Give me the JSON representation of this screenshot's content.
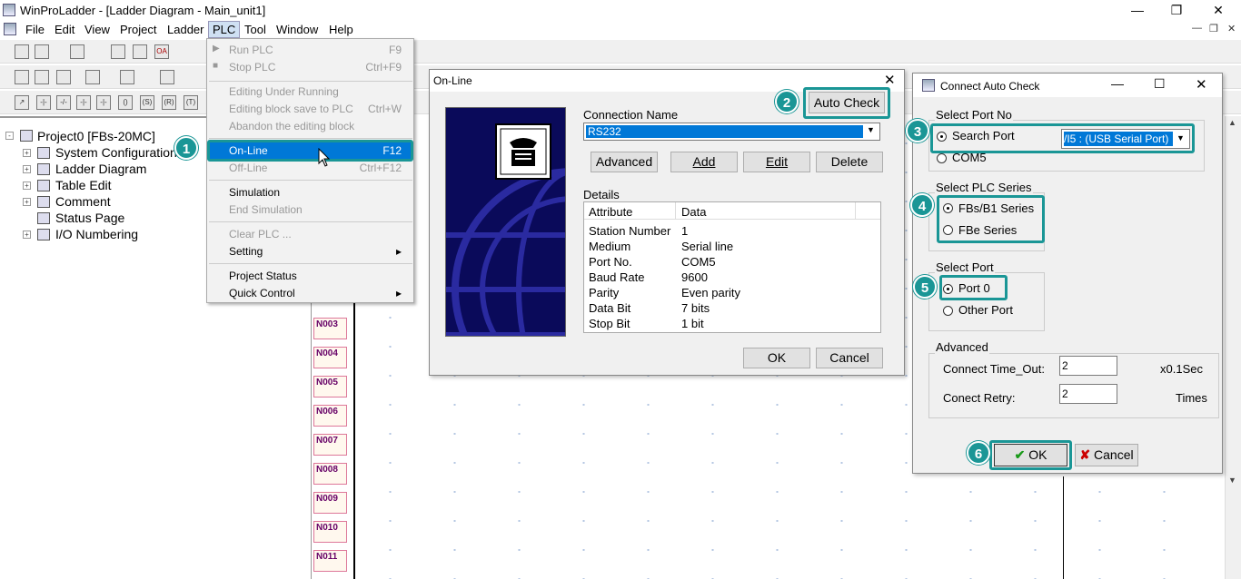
{
  "window": {
    "title": "WinProLadder - [Ladder Diagram - Main_unit1]"
  },
  "menubar": [
    "File",
    "Edit",
    "View",
    "Project",
    "Ladder",
    "PLC",
    "Tool",
    "Window",
    "Help"
  ],
  "plc_menu": {
    "items": [
      {
        "label": "Run PLC",
        "shortcut": "F9",
        "disabled": true
      },
      {
        "label": "Stop PLC",
        "shortcut": "Ctrl+F9",
        "disabled": true
      },
      {
        "label": "Editing Under Running",
        "shortcut": "",
        "disabled": true
      },
      {
        "label": "Editing block save to PLC",
        "shortcut": "Ctrl+W",
        "disabled": true
      },
      {
        "label": "Abandon the editing block",
        "shortcut": "",
        "disabled": true
      },
      {
        "label": "On-Line",
        "shortcut": "F12",
        "disabled": false
      },
      {
        "label": "Off-Line",
        "shortcut": "Ctrl+F12",
        "disabled": true
      },
      {
        "label": "Simulation",
        "shortcut": "",
        "disabled": false
      },
      {
        "label": "End Simulation",
        "shortcut": "",
        "disabled": true
      },
      {
        "label": "Clear PLC ...",
        "shortcut": "",
        "disabled": true
      },
      {
        "label": "Setting",
        "shortcut": "",
        "disabled": false
      },
      {
        "label": "Project Status",
        "shortcut": "",
        "disabled": false
      },
      {
        "label": "Quick Control",
        "shortcut": "",
        "disabled": false
      }
    ]
  },
  "tree": {
    "root": "Project0 [FBs-20MC]",
    "items": [
      "System Configuration",
      "Ladder Diagram",
      "Table Edit",
      "Comment",
      "Status Page",
      "I/O Numbering"
    ]
  },
  "ladder": {
    "rows": [
      "N003",
      "N004",
      "N005",
      "N006",
      "N007",
      "N008",
      "N009",
      "N010",
      "N011"
    ]
  },
  "online_dialog": {
    "title": "On-Line",
    "auto_check": "Auto Check",
    "connection_name_label": "Connection Name",
    "connection_name": "RS232",
    "buttons": {
      "advanced": "Advanced",
      "add": "Add",
      "edit": "Edit",
      "delete": "Delete",
      "ok": "OK",
      "cancel": "Cancel"
    },
    "details_label": "Details",
    "details_headers": [
      "Attribute",
      "Data"
    ],
    "details": [
      [
        "Station Number",
        "1"
      ],
      [
        "Medium",
        "Serial line"
      ],
      [
        "Port No.",
        "COM5"
      ],
      [
        "Baud Rate",
        "9600"
      ],
      [
        "Parity",
        "Even parity"
      ],
      [
        "Data Bit",
        "7 bits"
      ],
      [
        "Stop Bit",
        "1 bit"
      ]
    ]
  },
  "auto_dialog": {
    "title": "Connect Auto Check",
    "port_group": "Select Port No",
    "search_port": "Search Port",
    "port_select": "/I5 : (USB Serial Port)",
    "com5": "COM5",
    "series_group": "Select PLC Series",
    "series_fbs": "FBs/B1 Series",
    "series_fbe": "FBe Series",
    "selport_group": "Select Port",
    "port0": "Port 0",
    "other_port": "Other Port",
    "advanced_group": "Advanced",
    "timeout_label": "Connect Time_Out:",
    "timeout_value": "2",
    "timeout_unit": "x0.1Sec",
    "retry_label": "Conect Retry:",
    "retry_value": "2",
    "retry_unit": "Times",
    "ok": "OK",
    "cancel": "Cancel"
  },
  "badges": [
    "1",
    "2",
    "3",
    "4",
    "5",
    "6"
  ],
  "colors": {
    "highlight": "#1a9696",
    "selection": "#0078d7"
  }
}
